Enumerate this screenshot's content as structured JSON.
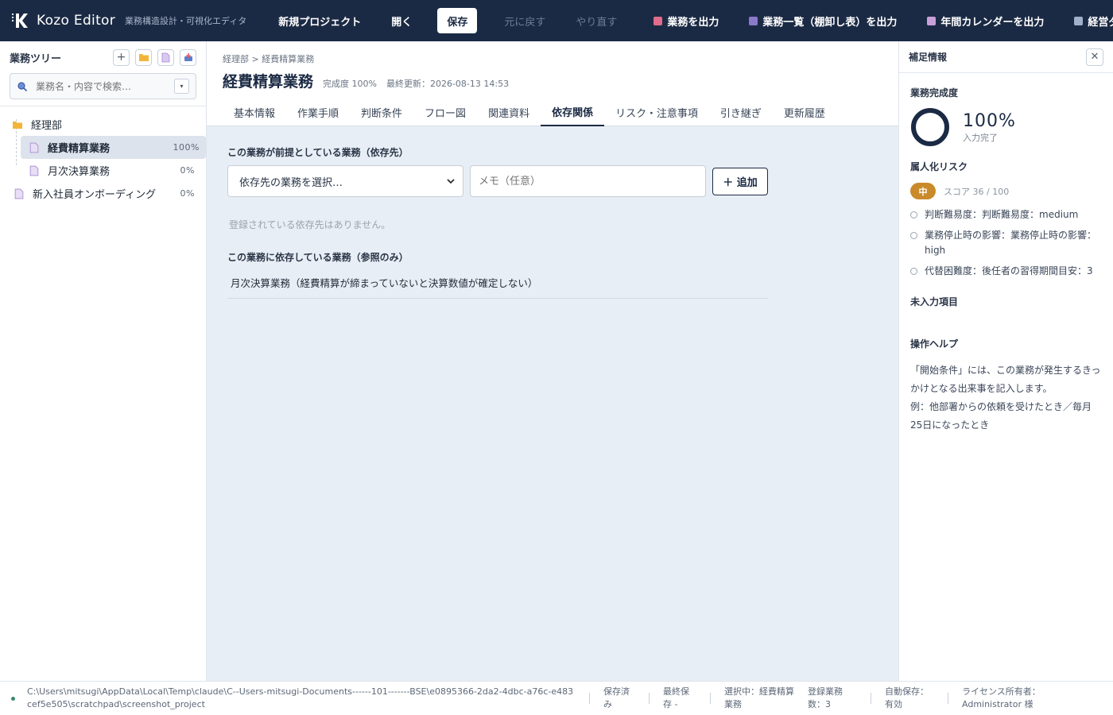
{
  "app": {
    "name": "Kozo Editor",
    "subtitle": "業務構造設計・可視化エディタ"
  },
  "toolbar": {
    "new_project": "新規プロジェクト",
    "open": "開く",
    "save": "保存",
    "undo": "元に戻す",
    "redo": "やり直す",
    "export_task": "業務を出力",
    "export_list": "業務一覧（棚卸し表）を出力",
    "export_calendar": "年間カレンダーを出力",
    "dashboard": "経営ダッシュボード"
  },
  "sidebar": {
    "title": "業務ツリー",
    "search_placeholder": "業務名・内容で検索…",
    "tree": {
      "folder": "経理部",
      "items": [
        {
          "label": "経費精算業務",
          "pct": "100%"
        },
        {
          "label": "月次決算業務",
          "pct": "0%"
        }
      ],
      "root_item": {
        "label": "新入社員オンボーディング",
        "pct": "0%"
      }
    }
  },
  "main": {
    "breadcrumb": "経理部 > 経費精算業務",
    "title": "経費精算業務",
    "completion": "完成度 100%",
    "last_updated": "最終更新：2026-08-13 14:53",
    "tabs": [
      "基本情報",
      "作業手順",
      "判断条件",
      "フロー図",
      "関連資料",
      "依存関係",
      "リスク・注意事項",
      "引き継ぎ",
      "更新履歴"
    ],
    "active_tab": "依存関係",
    "dependencies": {
      "prereq_label": "この業務が前提としている業務（依存先）",
      "select_placeholder": "依存先の業務を選択…",
      "memo_placeholder": "メモ（任意）",
      "add_button": "＋ 追加",
      "empty_message": "登録されている依存先はありません。",
      "dependents_label": "この業務に依存している業務（参照のみ）",
      "dependents": [
        "月次決算業務（経費精算が締まっていないと決算数値が確定しない）"
      ]
    }
  },
  "rpanel": {
    "title": "補足情報",
    "completion_label": "業務完成度",
    "completion_value": 100,
    "completion_text": "100%",
    "completion_sub": "入力完了",
    "risk_label": "属人化リスク",
    "risk_level": "中",
    "risk_score": "スコア 36 / 100",
    "risk_items": [
      "判断難易度：判断難易度：medium",
      "業務停止時の影響：業務停止時の影響：high",
      "代替困難度：後任者の習得期間目安：3"
    ],
    "missing_label": "未入力項目",
    "help_label": "操作ヘルプ",
    "help_text_1": "「開始条件」には、この業務が発生するきっかけとなる出来事を記入します。",
    "help_text_2": "例：他部署からの依頼を受けたとき／毎月25日になったとき"
  },
  "status": {
    "path": "C:\\Users\\mitsugi\\AppData\\Local\\Temp\\claude\\C--Users-mitsugi-Documents------101-------BSE\\e0895366-2da2-4dbc-a76c-e483cef5e505\\scratchpad\\screenshot_project",
    "saved": "保存済み",
    "last_saved": "最終保存 -",
    "selected": "選択中：経費精算業務",
    "count": "登録業務数：3",
    "autosave": "自動保存：有効",
    "license": "ライセンス所有者：Administrator 様"
  },
  "colors": {
    "navy": "#1b2a44",
    "risk_medium": "#c98a2a",
    "status_ok": "#3a8a6c"
  },
  "icons": [
    "logo-k",
    "search-icon",
    "plus-icon",
    "folder-icon",
    "doc-icon",
    "export-icon",
    "close-icon",
    "calendar-icon",
    "chart-icon"
  ]
}
